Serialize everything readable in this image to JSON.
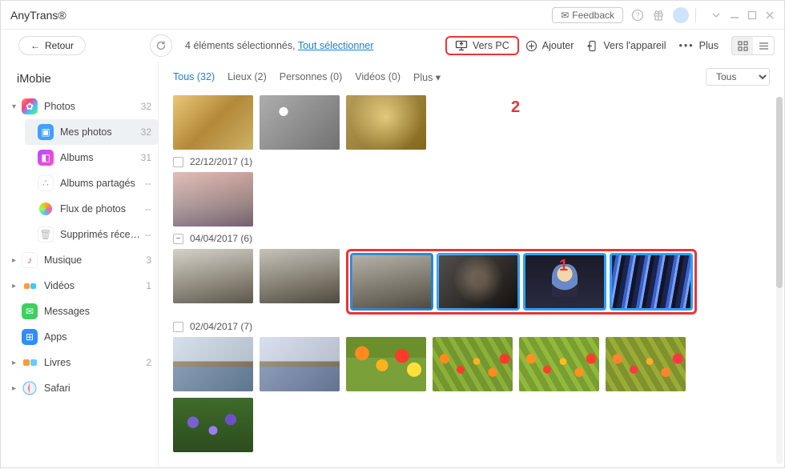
{
  "app": {
    "brand": "AnyTrans®"
  },
  "titlebar": {
    "feedback": "Feedback"
  },
  "header": {
    "back": "Retour",
    "selection_text": "4 éléments sélectionnés, ",
    "select_all": "Tout sélectionner",
    "to_pc": "Vers PC",
    "add": "Ajouter",
    "to_device": "Vers l'appareil",
    "more": "Plus"
  },
  "account": {
    "name": "iMobie"
  },
  "sidebar": {
    "items": [
      {
        "label": "Photos",
        "count": "32",
        "expanded": true
      },
      {
        "label": "Mes photos",
        "count": "32",
        "active": true
      },
      {
        "label": "Albums",
        "count": "31"
      },
      {
        "label": "Albums partagés",
        "count": "--"
      },
      {
        "label": "Flux de photos",
        "count": "--"
      },
      {
        "label": "Supprimés récemment",
        "count": "--"
      },
      {
        "label": "Musique",
        "count": "3"
      },
      {
        "label": "Vidéos",
        "count": "1"
      },
      {
        "label": "Messages",
        "count": ""
      },
      {
        "label": "Apps",
        "count": ""
      },
      {
        "label": "Livres",
        "count": "2"
      },
      {
        "label": "Safari",
        "count": ""
      }
    ]
  },
  "filters": {
    "tabs": [
      {
        "label": "Tous (32)",
        "active": true
      },
      {
        "label": "Lieux (2)"
      },
      {
        "label": "Personnes (0)"
      },
      {
        "label": "Vidéos (0)"
      },
      {
        "label": "Plus ▾"
      }
    ],
    "dropdown": "Tous"
  },
  "groups": [
    {
      "date": "22/12/2017 (1)",
      "checked": false
    },
    {
      "date": "04/04/2017 (6)",
      "checked": "partial"
    },
    {
      "date": "02/04/2017 (7)",
      "checked": false
    }
  ],
  "annotations": {
    "one": "1",
    "two": "2"
  }
}
